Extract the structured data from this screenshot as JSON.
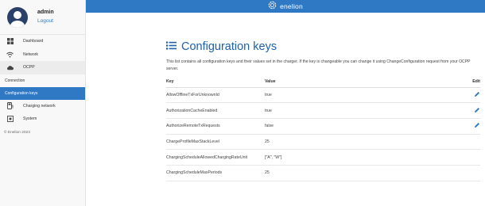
{
  "user": {
    "name": "admin",
    "logout_label": "Logout"
  },
  "brand": {
    "name": "enelion",
    "color": "#2f78c4"
  },
  "sidebar": {
    "items": [
      {
        "label": "Dashboard",
        "icon": "dashboard-icon"
      },
      {
        "label": "Network",
        "icon": "wifi-icon"
      },
      {
        "label": "OCPP",
        "icon": "cloud-icon"
      }
    ],
    "sub_items": [
      {
        "label": "Connection",
        "active": false
      },
      {
        "label": "Configuration keys",
        "active": true
      }
    ],
    "bottom_items": [
      {
        "label": "Charging network",
        "icon": "charging-network-icon"
      },
      {
        "label": "System",
        "icon": "system-icon"
      }
    ],
    "copyright": "© Enelion 2023"
  },
  "page": {
    "title": "Configuration keys",
    "description": "This list contains all configuration keys and their values set in the charger. If the key is changeable you can change it using ChangeConfiguration request from your OCPP server."
  },
  "table": {
    "headers": {
      "key": "Key",
      "value": "Value",
      "edit": "Edit"
    },
    "rows": [
      {
        "key": "AllowOfflineTxForUnknownId",
        "value": "true",
        "editable": true
      },
      {
        "key": "AuthorizationCacheEnabled",
        "value": "true",
        "editable": true
      },
      {
        "key": "AuthorizeRemoteTxRequests",
        "value": "false",
        "editable": true
      },
      {
        "key": "ChargeProfileMaxStackLevel",
        "value": "25",
        "editable": false
      },
      {
        "key": "ChargingScheduleAllowedChargingRateUnit",
        "value": "[\"A\", \"W\"]",
        "editable": false
      },
      {
        "key": "ChargingScheduleMaxPeriods",
        "value": "25",
        "editable": false
      }
    ]
  }
}
